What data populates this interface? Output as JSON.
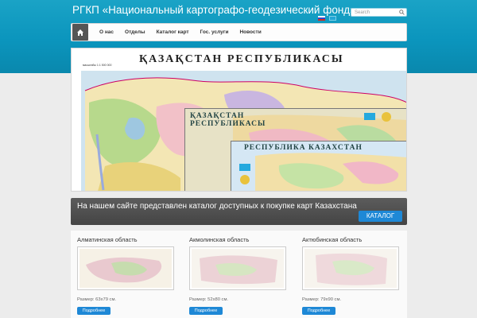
{
  "header": {
    "title": "РГКП «Национальный картографо-геодезический фонд»",
    "search_placeholder": "Search"
  },
  "nav": {
    "items": [
      "О нас",
      "Отделы",
      "Каталог карт",
      "Гос. услуги",
      "Новости"
    ]
  },
  "hero": {
    "main_title": "ҚАЗАҚСТАН  РЕСПУБЛИКАСЫ",
    "scale_text": "масштабы 1:1 500 000",
    "card1_title": "ҚАЗАҚСТАН\nРЕСПУБЛИКАСЫ",
    "card2_title": "РЕСПУБЛИКА  КАЗАХСТАН"
  },
  "banner": {
    "text": "На нашем сайте представлен каталог доступных к покупке карт Казахстана",
    "button_label": "КАТАЛОГ"
  },
  "regions": [
    {
      "name": "Алматинская область",
      "size": "Размер: 63х79 см.",
      "button": "Подробнее"
    },
    {
      "name": "Акмолинская область",
      "size": "Размер: 52х80 см.",
      "button": "Подробнее"
    },
    {
      "name": "Актюбинская область",
      "size": "Размер: 79х90 см.",
      "button": "Подробнее"
    }
  ],
  "colors": {
    "header_band": "#0b95bd",
    "accent_button": "#1e88d6",
    "banner_bg": "#4a4a4a"
  }
}
